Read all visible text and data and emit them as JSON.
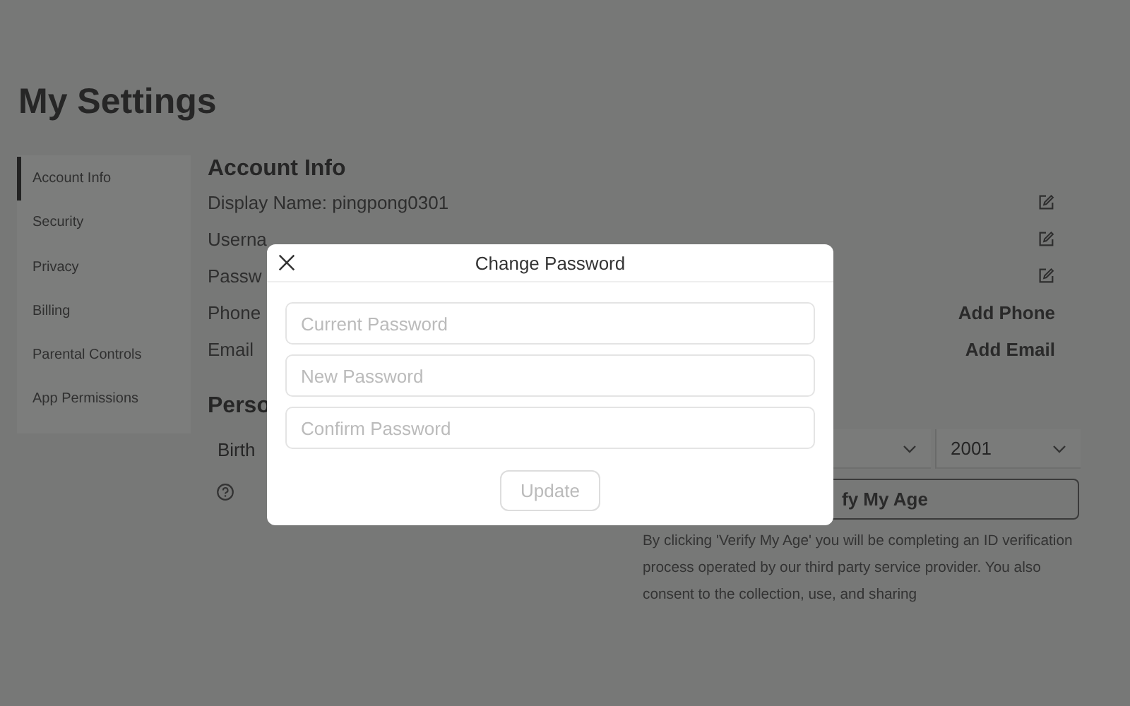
{
  "page": {
    "title": "My Settings"
  },
  "sidebar": {
    "items": [
      {
        "label": "Account Info",
        "selected": true
      },
      {
        "label": "Security",
        "selected": false
      },
      {
        "label": "Privacy",
        "selected": false
      },
      {
        "label": "Billing",
        "selected": false
      },
      {
        "label": "Parental Controls",
        "selected": false
      },
      {
        "label": "App Permissions",
        "selected": false
      }
    ]
  },
  "account_info": {
    "heading": "Account Info",
    "rows": [
      {
        "label": "Display Name: pingpong0301",
        "kind": "edit"
      },
      {
        "label": "Userna",
        "kind": "edit"
      },
      {
        "label": "Passw",
        "kind": "edit"
      },
      {
        "label": "Phone",
        "kind": "link",
        "action": "Add Phone"
      },
      {
        "label": "Email",
        "kind": "link",
        "action": "Add Email"
      }
    ]
  },
  "personal": {
    "heading": "Perso",
    "birthday_label": "Birth",
    "year": "2001",
    "verify_button": "fy My Age",
    "disclaimer": "By clicking 'Verify My Age' you will be completing an ID verification process operated by our third party service provider. You also consent to the collection, use, and sharing"
  },
  "dialog": {
    "title": "Change Password",
    "fields": [
      {
        "placeholder": "Current Password"
      },
      {
        "placeholder": "New Password"
      },
      {
        "placeholder": "Confirm Password"
      }
    ],
    "button": {
      "label": "Update",
      "disabled": true
    }
  }
}
